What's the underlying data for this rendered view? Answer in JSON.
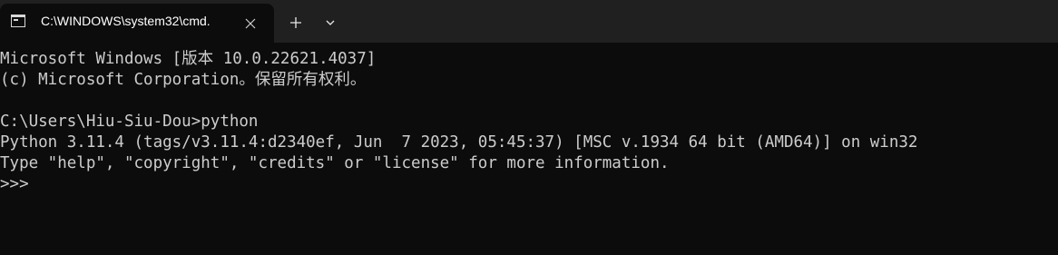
{
  "tab": {
    "title": "C:\\WINDOWS\\system32\\cmd.",
    "icon": "command-prompt-icon",
    "close_icon": "close-icon"
  },
  "tabstrip": {
    "new_tab_icon": "plus-icon",
    "dropdown_icon": "chevron-down-icon"
  },
  "colors": {
    "tabstrip_bg": "#202020",
    "console_bg": "#0c0c0c",
    "console_text": "#cccccc",
    "tab_text": "#ffffff"
  },
  "console": {
    "lines": [
      "Microsoft Windows [版本 10.0.22621.4037]",
      "(c) Microsoft Corporation。保留所有权利。",
      "",
      "C:\\Users\\Hiu-Siu-Dou>python",
      "Python 3.11.4 (tags/v3.11.4:d2340ef, Jun  7 2023, 05:45:37) [MSC v.1934 64 bit (AMD64)] on win32",
      "Type \"help\", \"copyright\", \"credits\" or \"license\" for more information.",
      ">>>"
    ]
  }
}
